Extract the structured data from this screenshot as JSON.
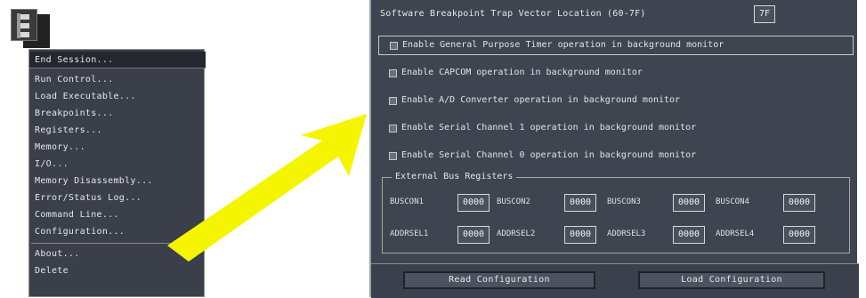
{
  "menu": {
    "items": [
      "End Session...",
      "Run Control...",
      "Load Executable...",
      "Breakpoints...",
      "Registers...",
      "Memory...",
      "I/O...",
      "Memory Disassembly...",
      "Error/Status Log...",
      "Command Line...",
      "Configuration...",
      "About...",
      "Delete"
    ]
  },
  "dialog": {
    "trap_vector_label": "Software Breakpoint Trap Vector Location (60-7F)",
    "trap_vector_value": "7F",
    "options": [
      "Enable General Purpose Timer operation in background monitor",
      "Enable CAPCOM operation in background monitor",
      "Enable A/D Converter operation in background monitor",
      "Enable Serial Channel 1 operation in background monitor",
      "Enable Serial Channel 0 operation in background monitor"
    ],
    "group_title": "External Bus Registers",
    "registers": [
      {
        "name": "BUSCON1",
        "value": "0000"
      },
      {
        "name": "BUSCON2",
        "value": "0000"
      },
      {
        "name": "BUSCON3",
        "value": "0000"
      },
      {
        "name": "BUSCON4",
        "value": "0000"
      },
      {
        "name": "ADDRSEL1",
        "value": "0000"
      },
      {
        "name": "ADDRSEL2",
        "value": "0000"
      },
      {
        "name": "ADDRSEL3",
        "value": "0000"
      },
      {
        "name": "ADDRSEL4",
        "value": "0000"
      }
    ],
    "read_button": "Read Configuration",
    "load_button": "Load Configuration"
  },
  "colors": {
    "menu_bg": "#3a3f4a",
    "dialog_bg": "#3e4551",
    "arrow": "#f5f500"
  },
  "icons": [
    "app-icon",
    "arrow-icon",
    "checkbox-icon"
  ]
}
